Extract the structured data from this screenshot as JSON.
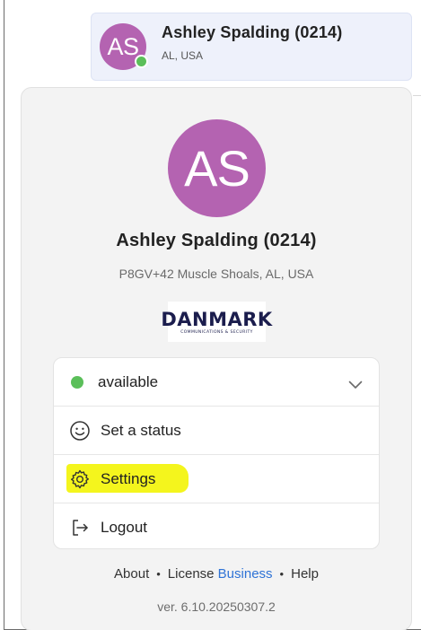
{
  "user_chip": {
    "initials": "AS",
    "name": "Ashley Spalding (0214)",
    "location": "AL, USA",
    "avatar_color": "#b463b1",
    "presence_color": "#5bbf5a"
  },
  "profile": {
    "initials": "AS",
    "name": "Ashley Spalding (0214)",
    "address": "P8GV+42 Muscle Shoals, AL, USA",
    "logo_text": "DANMARK",
    "logo_subtext": "COMMUNICATIONS & SECURITY"
  },
  "menu": {
    "availability": "available",
    "set_status": "Set a status",
    "settings": "Settings",
    "logout": "Logout"
  },
  "footer": {
    "about": "About",
    "separator": "•",
    "license": "License",
    "license_tier": "Business",
    "help": "Help",
    "version": "ver. 6.10.20250307.2"
  },
  "colors": {
    "accent_blue": "#2f73d6",
    "highlight_yellow": "#f4f51d"
  },
  "icons": {
    "availability_chevron": "chevron-down-icon",
    "set_status": "smiley-icon",
    "settings": "gear-icon",
    "logout": "logout-icon"
  }
}
